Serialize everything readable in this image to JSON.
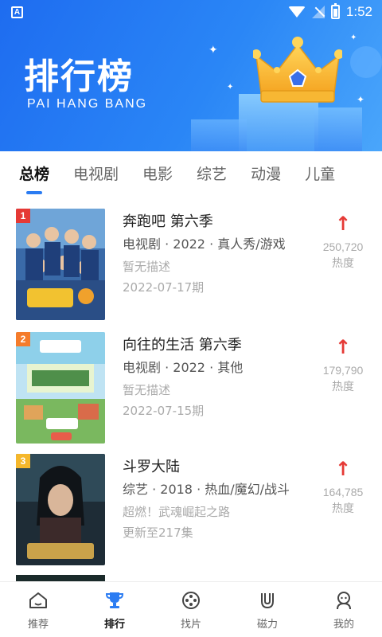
{
  "status_bar": {
    "time": "1:52",
    "app_badge": "A"
  },
  "banner": {
    "title": "排行榜",
    "subtitle": "PAI HANG BANG"
  },
  "tabs": [
    {
      "label": "总榜",
      "active": true
    },
    {
      "label": "电视剧",
      "active": false
    },
    {
      "label": "电影",
      "active": false
    },
    {
      "label": "综艺",
      "active": false
    },
    {
      "label": "动漫",
      "active": false
    },
    {
      "label": "儿童",
      "active": false
    }
  ],
  "items": [
    {
      "rank": "1",
      "rank_color": "#e53935",
      "title": "奔跑吧 第六季",
      "meta": "电视剧 · 2022 · 真人秀/游戏",
      "desc": "暂无描述",
      "date": "2022-07-17期",
      "heat_value": "250,720",
      "heat_label": "热度"
    },
    {
      "rank": "2",
      "rank_color": "#f57c2b",
      "title": "向往的生活 第六季",
      "meta": "电视剧 · 2022 · 其他",
      "desc": "暂无描述",
      "date": "2022-07-15期",
      "heat_value": "179,790",
      "heat_label": "热度"
    },
    {
      "rank": "3",
      "rank_color": "#f5b72b",
      "title": "斗罗大陆",
      "meta": "综艺 · 2018 · 热血/魔幻/战斗",
      "desc": "超燃！武魂崛起之路",
      "date": "更新至217集",
      "heat_value": "164,785",
      "heat_label": "热度"
    }
  ],
  "bottom_nav": [
    {
      "label": "推荐",
      "icon": "home-icon",
      "active": false
    },
    {
      "label": "排行",
      "icon": "trophy-icon",
      "active": true
    },
    {
      "label": "找片",
      "icon": "film-reel-icon",
      "active": false
    },
    {
      "label": "磁力",
      "icon": "magnet-icon",
      "active": false
    },
    {
      "label": "我的",
      "icon": "profile-icon",
      "active": false
    }
  ],
  "colors": {
    "accent": "#2b7cf2",
    "heat_arrow": "#e53935"
  }
}
